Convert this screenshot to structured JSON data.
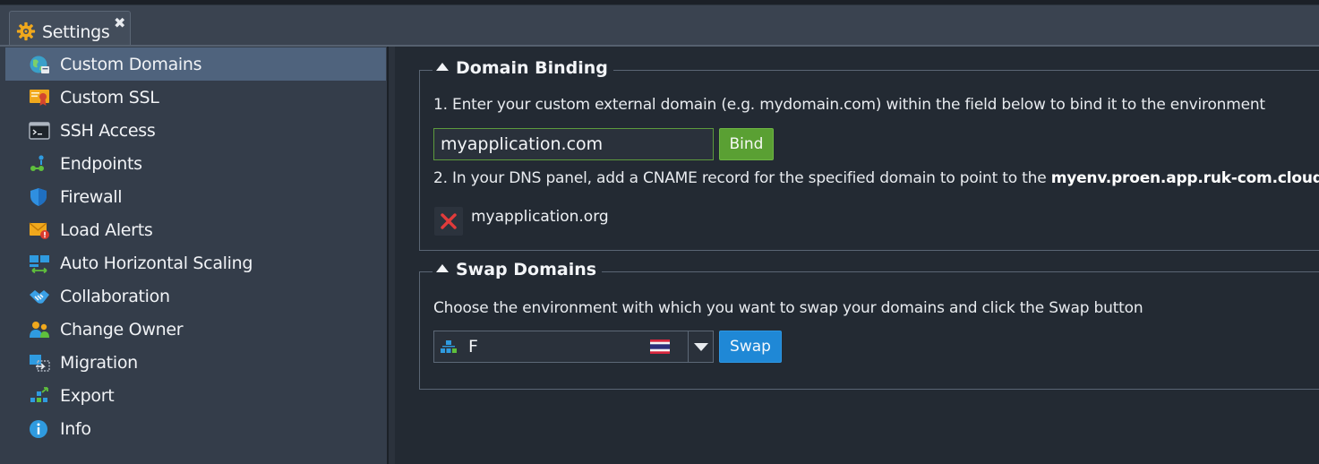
{
  "tab": {
    "title": "Settings",
    "close_glyph": "✖"
  },
  "sidebar": {
    "items": [
      {
        "label": "Custom Domains",
        "icon": "globe-icon",
        "active": true
      },
      {
        "label": "Custom SSL",
        "icon": "certificate-icon"
      },
      {
        "label": "SSH Access",
        "icon": "terminal-icon"
      },
      {
        "label": "Endpoints",
        "icon": "endpoints-icon"
      },
      {
        "label": "Firewall",
        "icon": "shield-icon"
      },
      {
        "label": "Load Alerts",
        "icon": "alert-envelope-icon"
      },
      {
        "label": "Auto Horizontal Scaling",
        "icon": "scaling-icon"
      },
      {
        "label": "Collaboration",
        "icon": "handshake-icon"
      },
      {
        "label": "Change Owner",
        "icon": "users-icon"
      },
      {
        "label": "Migration",
        "icon": "migration-icon"
      },
      {
        "label": "Export",
        "icon": "export-icon"
      },
      {
        "label": "Info",
        "icon": "info-icon"
      }
    ]
  },
  "domain_binding": {
    "title": "Domain Binding",
    "step1": "1. Enter your custom external domain (e.g. mydomain.com) within the field below to bind it to the environment",
    "input_value": "myapplication.com",
    "bind_label": "Bind",
    "step2_prefix": "2. In your DNS panel, add a CNAME record for the specified domain to point to the ",
    "step2_host": "myenv.proen.app.ruk-com.cloud",
    "bound_domains": [
      "myapplication.org"
    ]
  },
  "swap_domains": {
    "title": "Swap Domains",
    "description": "Choose the environment with which you want to swap your domains and click the Swap button",
    "selected_env": "F",
    "swap_label": "Swap"
  },
  "colors": {
    "accent_green": "#5aa033",
    "accent_blue": "#1f88d6",
    "active_item": "#4f637d",
    "remove_red": "#e23b3b"
  }
}
